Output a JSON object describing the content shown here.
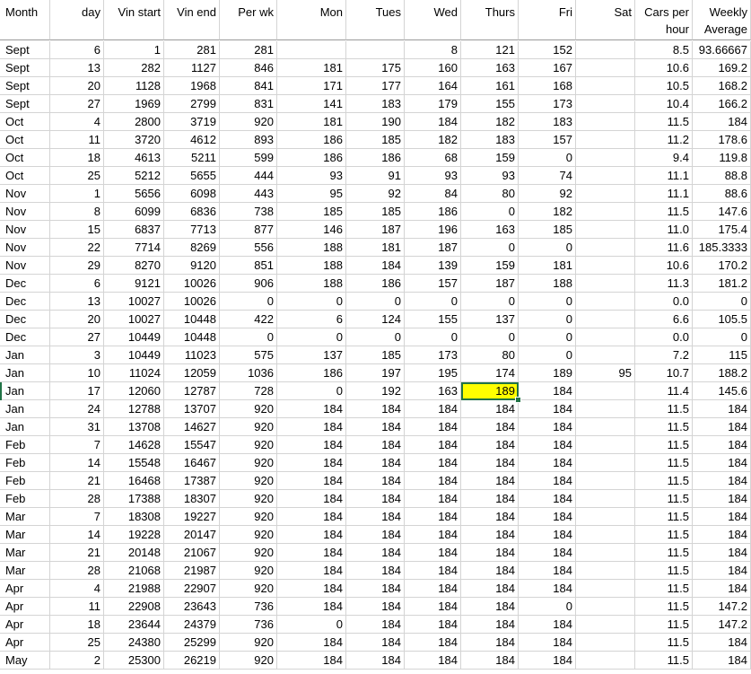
{
  "colors": {
    "highlight": "#ffff00",
    "selection": "#217346",
    "gridline": "#d4d4d4"
  },
  "selected_cell": {
    "row": 19,
    "col": 8
  },
  "headers": [
    {
      "lines": [
        "Month"
      ],
      "align": "left"
    },
    {
      "lines": [
        "day"
      ]
    },
    {
      "lines": [
        "Vin start"
      ]
    },
    {
      "lines": [
        "Vin end"
      ]
    },
    {
      "lines": [
        "Per wk"
      ]
    },
    {
      "lines": [
        "Mon"
      ]
    },
    {
      "lines": [
        "Tues"
      ]
    },
    {
      "lines": [
        "Wed"
      ]
    },
    {
      "lines": [
        "Thurs"
      ]
    },
    {
      "lines": [
        "Fri"
      ]
    },
    {
      "lines": [
        "Sat"
      ]
    },
    {
      "lines": [
        "Cars per",
        "hour"
      ]
    },
    {
      "lines": [
        "Weekly",
        "Average"
      ]
    }
  ],
  "rows": [
    [
      "Sept",
      "6",
      "1",
      "281",
      "281",
      "",
      "",
      "8",
      "121",
      "152",
      "",
      "8.5",
      "93.66667"
    ],
    [
      "Sept",
      "13",
      "282",
      "1127",
      "846",
      "181",
      "175",
      "160",
      "163",
      "167",
      "",
      "10.6",
      "169.2"
    ],
    [
      "Sept",
      "20",
      "1128",
      "1968",
      "841",
      "171",
      "177",
      "164",
      "161",
      "168",
      "",
      "10.5",
      "168.2"
    ],
    [
      "Sept",
      "27",
      "1969",
      "2799",
      "831",
      "141",
      "183",
      "179",
      "155",
      "173",
      "",
      "10.4",
      "166.2"
    ],
    [
      "Oct",
      "4",
      "2800",
      "3719",
      "920",
      "181",
      "190",
      "184",
      "182",
      "183",
      "",
      "11.5",
      "184"
    ],
    [
      "Oct",
      "11",
      "3720",
      "4612",
      "893",
      "186",
      "185",
      "182",
      "183",
      "157",
      "",
      "11.2",
      "178.6"
    ],
    [
      "Oct",
      "18",
      "4613",
      "5211",
      "599",
      "186",
      "186",
      "68",
      "159",
      "0",
      "",
      "9.4",
      "119.8"
    ],
    [
      "Oct",
      "25",
      "5212",
      "5655",
      "444",
      "93",
      "91",
      "93",
      "93",
      "74",
      "",
      "11.1",
      "88.8"
    ],
    [
      "Nov",
      "1",
      "5656",
      "6098",
      "443",
      "95",
      "92",
      "84",
      "80",
      "92",
      "",
      "11.1",
      "88.6"
    ],
    [
      "Nov",
      "8",
      "6099",
      "6836",
      "738",
      "185",
      "185",
      "186",
      "0",
      "182",
      "",
      "11.5",
      "147.6"
    ],
    [
      "Nov",
      "15",
      "6837",
      "7713",
      "877",
      "146",
      "187",
      "196",
      "163",
      "185",
      "",
      "11.0",
      "175.4"
    ],
    [
      "Nov",
      "22",
      "7714",
      "8269",
      "556",
      "188",
      "181",
      "187",
      "0",
      "0",
      "",
      "11.6",
      "185.3333"
    ],
    [
      "Nov",
      "29",
      "8270",
      "9120",
      "851",
      "188",
      "184",
      "139",
      "159",
      "181",
      "",
      "10.6",
      "170.2"
    ],
    [
      "Dec",
      "6",
      "9121",
      "10026",
      "906",
      "188",
      "186",
      "157",
      "187",
      "188",
      "",
      "11.3",
      "181.2"
    ],
    [
      "Dec",
      "13",
      "10027",
      "10026",
      "0",
      "0",
      "0",
      "0",
      "0",
      "0",
      "",
      "0.0",
      "0"
    ],
    [
      "Dec",
      "20",
      "10027",
      "10448",
      "422",
      "6",
      "124",
      "155",
      "137",
      "0",
      "",
      "6.6",
      "105.5"
    ],
    [
      "Dec",
      "27",
      "10449",
      "10448",
      "0",
      "0",
      "0",
      "0",
      "0",
      "0",
      "",
      "0.0",
      "0"
    ],
    [
      "Jan",
      "3",
      "10449",
      "11023",
      "575",
      "137",
      "185",
      "173",
      "80",
      "0",
      "",
      "7.2",
      "115"
    ],
    [
      "Jan",
      "10",
      "11024",
      "12059",
      "1036",
      "186",
      "197",
      "195",
      "174",
      "189",
      "95",
      "10.7",
      "188.2"
    ],
    [
      "Jan",
      "17",
      "12060",
      "12787",
      "728",
      "0",
      "192",
      "163",
      "189",
      "184",
      "",
      "11.4",
      "145.6"
    ],
    [
      "Jan",
      "24",
      "12788",
      "13707",
      "920",
      "184",
      "184",
      "184",
      "184",
      "184",
      "",
      "11.5",
      "184"
    ],
    [
      "Jan",
      "31",
      "13708",
      "14627",
      "920",
      "184",
      "184",
      "184",
      "184",
      "184",
      "",
      "11.5",
      "184"
    ],
    [
      "Feb",
      "7",
      "14628",
      "15547",
      "920",
      "184",
      "184",
      "184",
      "184",
      "184",
      "",
      "11.5",
      "184"
    ],
    [
      "Feb",
      "14",
      "15548",
      "16467",
      "920",
      "184",
      "184",
      "184",
      "184",
      "184",
      "",
      "11.5",
      "184"
    ],
    [
      "Feb",
      "21",
      "16468",
      "17387",
      "920",
      "184",
      "184",
      "184",
      "184",
      "184",
      "",
      "11.5",
      "184"
    ],
    [
      "Feb",
      "28",
      "17388",
      "18307",
      "920",
      "184",
      "184",
      "184",
      "184",
      "184",
      "",
      "11.5",
      "184"
    ],
    [
      "Mar",
      "7",
      "18308",
      "19227",
      "920",
      "184",
      "184",
      "184",
      "184",
      "184",
      "",
      "11.5",
      "184"
    ],
    [
      "Mar",
      "14",
      "19228",
      "20147",
      "920",
      "184",
      "184",
      "184",
      "184",
      "184",
      "",
      "11.5",
      "184"
    ],
    [
      "Mar",
      "21",
      "20148",
      "21067",
      "920",
      "184",
      "184",
      "184",
      "184",
      "184",
      "",
      "11.5",
      "184"
    ],
    [
      "Mar",
      "28",
      "21068",
      "21987",
      "920",
      "184",
      "184",
      "184",
      "184",
      "184",
      "",
      "11.5",
      "184"
    ],
    [
      "Apr",
      "4",
      "21988",
      "22907",
      "920",
      "184",
      "184",
      "184",
      "184",
      "184",
      "",
      "11.5",
      "184"
    ],
    [
      "Apr",
      "11",
      "22908",
      "23643",
      "736",
      "184",
      "184",
      "184",
      "184",
      "0",
      "",
      "11.5",
      "147.2"
    ],
    [
      "Apr",
      "18",
      "23644",
      "24379",
      "736",
      "0",
      "184",
      "184",
      "184",
      "184",
      "",
      "11.5",
      "147.2"
    ],
    [
      "Apr",
      "25",
      "24380",
      "25299",
      "920",
      "184",
      "184",
      "184",
      "184",
      "184",
      "",
      "11.5",
      "184"
    ],
    [
      "May",
      "2",
      "25300",
      "26219",
      "920",
      "184",
      "184",
      "184",
      "184",
      "184",
      "",
      "11.5",
      "184"
    ]
  ]
}
